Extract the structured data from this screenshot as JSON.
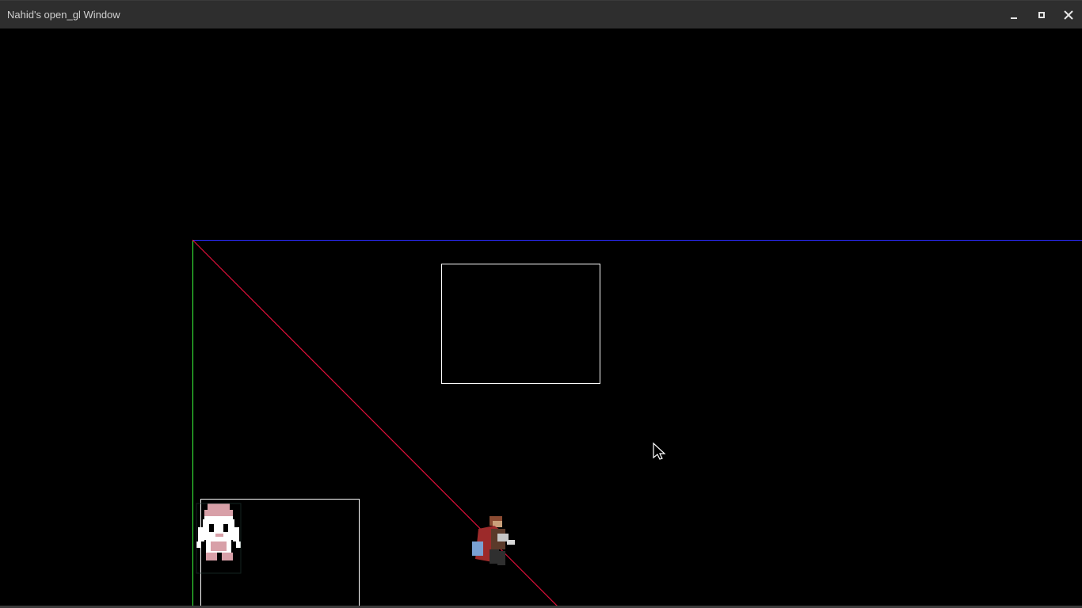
{
  "window": {
    "title": "Nahid's open_gl Window",
    "controls": {
      "minimize": "minimize-icon",
      "maximize": "maximize-icon",
      "close": "close-icon"
    }
  },
  "scene": {
    "background_color": "#000000",
    "axis_x_color": "#2a2aff",
    "axis_y_color": "#3cff3c",
    "diagonal_color": "#e0103a",
    "box_color": "#ffffff",
    "sprites": [
      "player-character-sprite",
      "enemy-character-sprite"
    ],
    "cursor": "mouse-cursor-icon"
  }
}
